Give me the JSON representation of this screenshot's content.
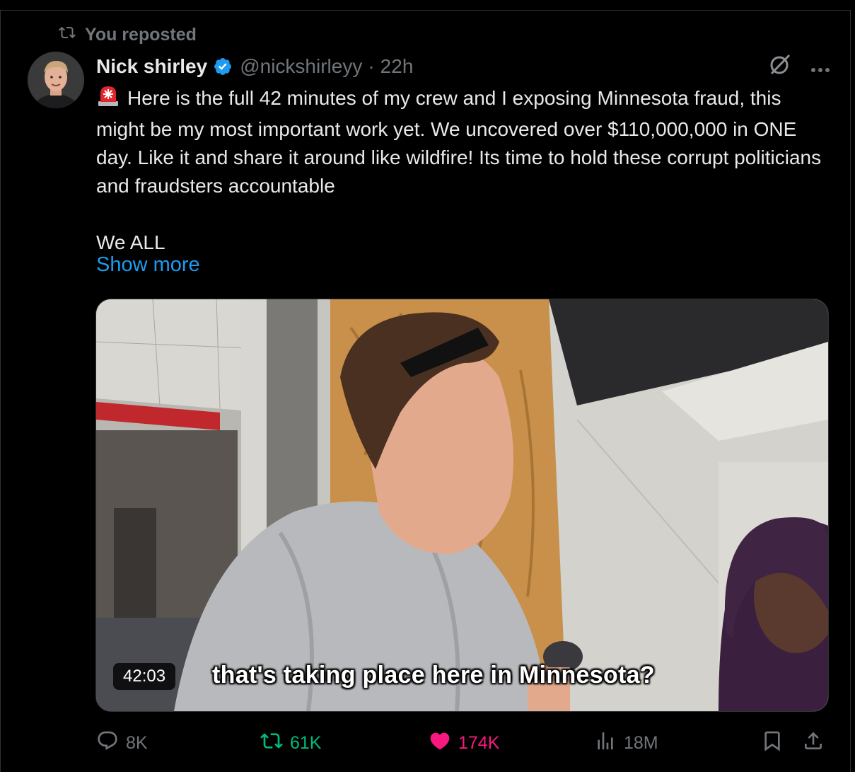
{
  "repost": {
    "label": "You reposted"
  },
  "author": {
    "name": "Nick shirley",
    "handle": "@nickshirleyy",
    "separator": "·",
    "time": "22h",
    "verified_color": "#1d9bf0"
  },
  "tweet": {
    "emoji": "siren-emoji",
    "text": "Here is the full 42 minutes of my crew and I exposing Minnesota fraud, this might be my most important work yet. We uncovered over $110,000,000 in ONE day. Like it and share it around like wildfire! Its time to hold these corrupt politicians and fraudsters accountable\n\nWe ALL",
    "show_more": "Show more"
  },
  "media": {
    "duration": "42:03",
    "caption": "that's taking place here in Minnesota?"
  },
  "actions": {
    "replies": "8K",
    "reposts": "61K",
    "likes": "174K",
    "views": "18M",
    "repost_color": "#00ba7c",
    "like_color": "#f91880"
  },
  "colors": {
    "background": "#000000",
    "text": "#e7e9ea",
    "muted": "#71767b",
    "link": "#1d9bf0"
  }
}
